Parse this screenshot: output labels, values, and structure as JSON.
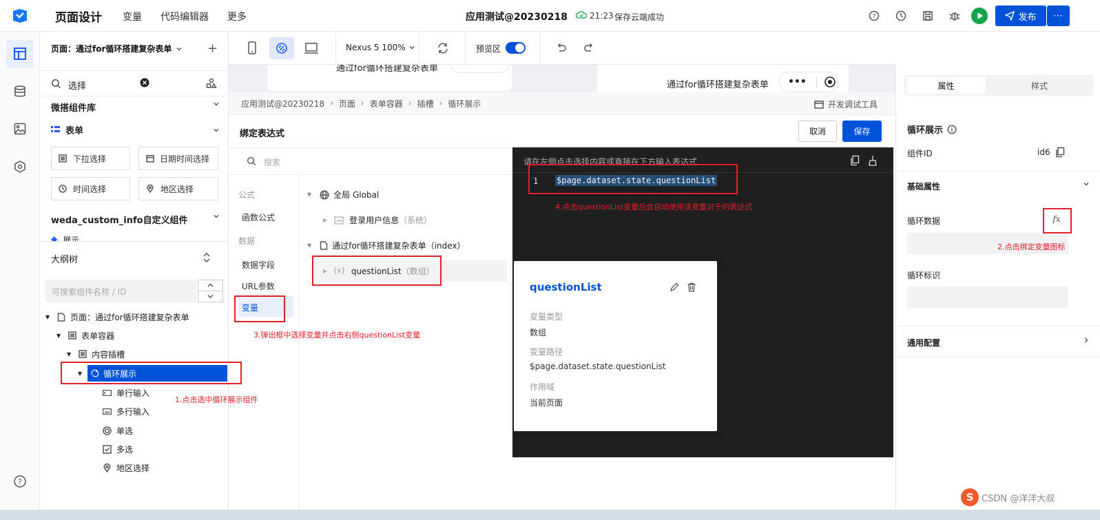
{
  "topbar": {
    "title": "页面设计",
    "nav": [
      "变量",
      "代码编辑器",
      "更多"
    ],
    "app_name": "应用测试@20230218",
    "save_time": "21:23",
    "save_status": "保存云端成功",
    "publish": "发布"
  },
  "left_panel": {
    "page_selector": "页面：通过for循环搭建复杂表单",
    "search_value": "选择",
    "groups": {
      "weda": "微搭组件库",
      "form": "表单",
      "custom": "weda_custom_info自定义组件",
      "show": "展示"
    },
    "components": [
      "下拉选择",
      "日期时间选择",
      "时间选择",
      "地区选择"
    ],
    "outline_title": "大纲树",
    "outline_search_placeholder": "可搜索组件名称 / ID",
    "tree": [
      {
        "label": "页面：通过for循环搭建复杂表单"
      },
      {
        "label": "表单容器"
      },
      {
        "label": "内容插槽"
      },
      {
        "label": "循环展示"
      },
      {
        "label": "单行输入"
      },
      {
        "label": "多行输入"
      },
      {
        "label": "单选"
      },
      {
        "label": "多选"
      },
      {
        "label": "地区选择"
      }
    ]
  },
  "canvas_bar": {
    "device": "Nexus 5 100%",
    "preview_label": "预览区",
    "preview_on": true
  },
  "preview": {
    "page_title_left": "通过for循环搭建复杂表单",
    "page_title_right": "通过for循环搭建复杂表单"
  },
  "breadcrumb": [
    "应用测试@20230218",
    "页面",
    "表单容器",
    "插槽",
    "循环展示"
  ],
  "devtools": "开发调试工具",
  "dialog": {
    "title": "绑定表达式",
    "cancel": "取消",
    "save": "保存",
    "search_placeholder": "搜索",
    "categories": [
      {
        "label": "公式",
        "type": "header"
      },
      {
        "label": "函数公式",
        "type": "item"
      },
      {
        "label": "数据",
        "type": "header"
      },
      {
        "label": "数据字段",
        "type": "item"
      },
      {
        "label": "URL参数",
        "type": "item"
      },
      {
        "label": "变量",
        "type": "item-active"
      }
    ],
    "tree": {
      "global": "全局 Global",
      "login_user": "登录用户信息",
      "login_user_tag": "（系统）",
      "page": "通过for循环搭建复杂表单（index）",
      "var_icon": "{x}",
      "var_name": "questionList",
      "var_tag": "（数组）"
    },
    "editor": {
      "hint": "请在左侧点击选择内容或直接在下方输入表达式",
      "line_no": "1",
      "expression": "$page.dataset.state.questionList"
    },
    "popover": {
      "name": "questionList",
      "type_label": "变量类型",
      "type_value": "数组",
      "path_label": "变量路径",
      "path_value": "$page.dataset.state.questionList",
      "scope_label": "作用域",
      "scope_value": "当前页面"
    }
  },
  "right_panel": {
    "tabs": [
      "属性",
      "样式"
    ],
    "component_name": "循环展示",
    "id_label": "组件ID",
    "id_value": "id6",
    "basic_props": "基础属性",
    "loop_data": "循环数据",
    "fx": "fx",
    "loop_key": "循环标识",
    "general_config": "通用配置"
  },
  "annotations": {
    "a1": "1.点击选中循环展示组件",
    "a2": "2.点击绑定变量图标",
    "a3": "3.弹出框中选择变量并点击右侧questionList变量",
    "a4": "4.点击questionList变量后会自动使用该变量对于的表达式"
  },
  "watermark": "CSDN @洋洋大叔",
  "colors": {
    "primary": "#0052d9",
    "annotation": "#e0202a",
    "editor_bg": "#1f1f1f",
    "run_green": "#16a34a"
  }
}
